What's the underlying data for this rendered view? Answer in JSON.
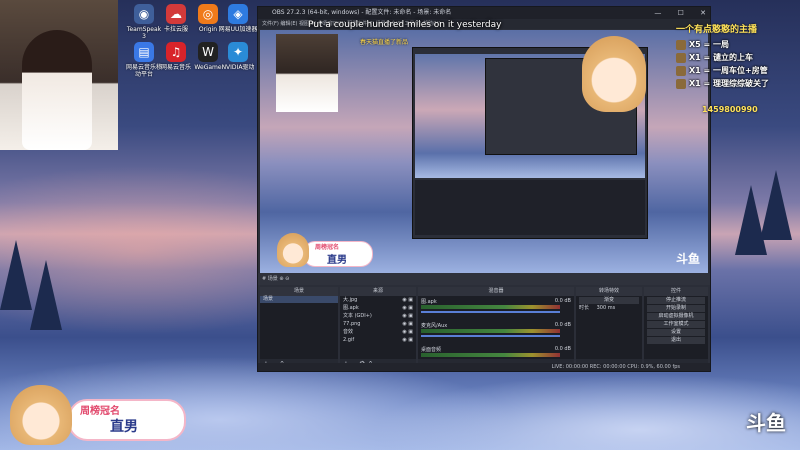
{
  "desktop": {
    "icons": [
      {
        "label": "TeamSpeak 3",
        "icon": "teamspeak-icon",
        "color": "#3f5f9a",
        "glyph": "◉"
      },
      {
        "label": "卡拉云服",
        "icon": "cloud-icon",
        "color": "#d33a3a",
        "glyph": "☁"
      },
      {
        "label": "Origin",
        "icon": "origin-icon",
        "color": "#f07a1a",
        "glyph": "◎"
      },
      {
        "label": "网易UU加速器",
        "icon": "uu-icon",
        "color": "#2e7be0",
        "glyph": "◈"
      },
      {
        "label": "网易云音乐移动平台",
        "icon": "music-folder-icon",
        "color": "#3a78e6",
        "glyph": "▤"
      },
      {
        "label": "网易云音乐",
        "icon": "netease-music-icon",
        "color": "#d8232a",
        "glyph": "♫"
      },
      {
        "label": "WeGame",
        "icon": "wegame-icon",
        "color": "#222222",
        "glyph": "W"
      },
      {
        "label": "NVIDIA驱动",
        "icon": "nvidia-icon",
        "color": "#2a8bd6",
        "glyph": "✦"
      }
    ]
  },
  "obs": {
    "title": "OBS 27.2.3 (64-bit, windows) - 配置文件: 未命名 - 场景: 未命名",
    "menu": "文件(F)  编辑(E)  视图(V)  停靠窗口(D)  配置文件(P)  场景集合(S)  工具(T)  帮助(H)",
    "window_buttons": [
      "—",
      "☐",
      "✕"
    ],
    "caption": "Put a couple hundred miles on it yesterday",
    "subcaption": "春天猫直播了新品",
    "scene_bar": "# 场景  ⊕  ⊖",
    "docks": {
      "scenes": {
        "title": "场景",
        "items": [
          "场景"
        ]
      },
      "sources": {
        "title": "来源",
        "items": [
          "大.jpg",
          "图.apk",
          "文本 (GDI+)",
          "77.png",
          "音效",
          "2.gif"
        ]
      },
      "mixer": {
        "title": "混音器",
        "channels": [
          {
            "name": "图.apk",
            "db": "0.0 dB"
          },
          {
            "name": "麦克风/Aux",
            "db": "0.0 dB"
          },
          {
            "name": "桌面音频",
            "db": "0.0 dB"
          }
        ]
      },
      "transitions": {
        "title": "转场特效",
        "type": "渐变",
        "duration_label": "时长",
        "duration": "300 ms"
      },
      "controls": {
        "title": "控件",
        "buttons": [
          "停止推流",
          "开始录制",
          "启动虚拟摄像机",
          "工作室模式",
          "设置",
          "退出"
        ]
      }
    },
    "status": "LIVE: 00:00:00  REC: 00:00:00  CPU: 0.9%, 60.00 fps"
  },
  "overlay": {
    "chat_title": "一个有点憨憨的主播",
    "chat": [
      {
        "text": "X5 = 一局",
        "icon": "pencil-icon"
      },
      {
        "text": "X1 = 谴立的上车",
        "icon": "gift-icon"
      },
      {
        "text": "X1 = 一周车位+房管",
        "icon": "gift-icon"
      },
      {
        "text": "X1 = 理理综综破关了",
        "icon": "gift-icon"
      }
    ],
    "chat_id": "1459800990",
    "badge_top": "周榜冠名",
    "badge_name": "直男",
    "platform_logo": "斗鱼"
  }
}
